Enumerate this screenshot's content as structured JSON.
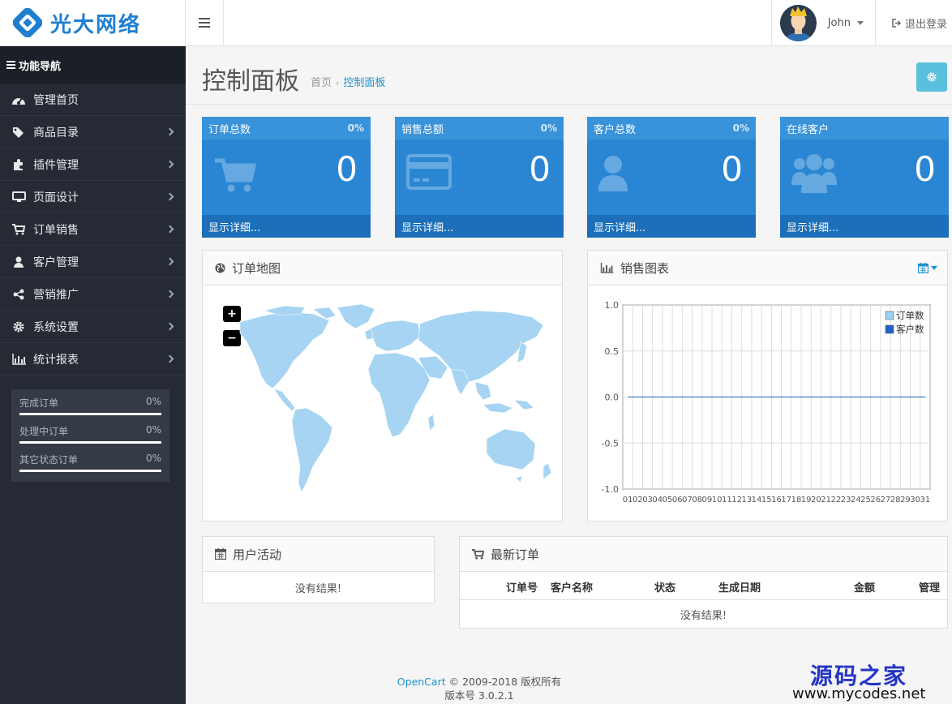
{
  "header": {
    "brand": "光大网络",
    "user_name": "John",
    "logout_label": "退出登录"
  },
  "sidebar": {
    "title": "功能导航",
    "items": [
      {
        "label": "管理首页",
        "icon": "dashboard-icon",
        "has_children": false
      },
      {
        "label": "商品目录",
        "icon": "tag-icon",
        "has_children": true
      },
      {
        "label": "插件管理",
        "icon": "puzzle-icon",
        "has_children": true
      },
      {
        "label": "页面设计",
        "icon": "desktop-icon",
        "has_children": true
      },
      {
        "label": "订单销售",
        "icon": "cart-icon",
        "has_children": true
      },
      {
        "label": "客户管理",
        "icon": "user-icon",
        "has_children": true
      },
      {
        "label": "营销推广",
        "icon": "share-icon",
        "has_children": true
      },
      {
        "label": "系统设置",
        "icon": "cog-icon",
        "has_children": true
      },
      {
        "label": "统计报表",
        "icon": "bar-chart-icon",
        "has_children": true
      }
    ],
    "progress": [
      {
        "label": "完成订单",
        "value": "0%"
      },
      {
        "label": "处理中订单",
        "value": "0%"
      },
      {
        "label": "其它状态订单",
        "value": "0%"
      }
    ]
  },
  "page": {
    "title": "控制面板",
    "breadcrumb_home": "首页",
    "breadcrumb_current": "控制面板"
  },
  "tiles": [
    {
      "title": "订单总数",
      "percent": "0%",
      "value": "0",
      "footer": "显示详细...",
      "icon": "cart-icon"
    },
    {
      "title": "销售总额",
      "percent": "0%",
      "value": "0",
      "footer": "显示详细...",
      "icon": "credit-card-icon"
    },
    {
      "title": "客户总数",
      "percent": "0%",
      "value": "0",
      "footer": "显示详细...",
      "icon": "user-icon"
    },
    {
      "title": "在线客户",
      "percent": "",
      "value": "0",
      "footer": "显示详细...",
      "icon": "users-icon"
    }
  ],
  "map_panel": {
    "title": "订单地图",
    "zoom_in": "+",
    "zoom_out": "−"
  },
  "chart_panel": {
    "title": "销售图表"
  },
  "chart_data": {
    "type": "line",
    "x": [
      "01",
      "02",
      "03",
      "04",
      "05",
      "06",
      "07",
      "08",
      "09",
      "10",
      "11",
      "12",
      "13",
      "14",
      "15",
      "16",
      "17",
      "18",
      "19",
      "20",
      "21",
      "22",
      "23",
      "24",
      "25",
      "26",
      "27",
      "28",
      "29",
      "30",
      "31"
    ],
    "series": [
      {
        "name": "订单数",
        "values": [
          0,
          0,
          0,
          0,
          0,
          0,
          0,
          0,
          0,
          0,
          0,
          0,
          0,
          0,
          0,
          0,
          0,
          0,
          0,
          0,
          0,
          0,
          0,
          0,
          0,
          0,
          0,
          0,
          0,
          0,
          0
        ]
      },
      {
        "name": "客户数",
        "values": [
          0,
          0,
          0,
          0,
          0,
          0,
          0,
          0,
          0,
          0,
          0,
          0,
          0,
          0,
          0,
          0,
          0,
          0,
          0,
          0,
          0,
          0,
          0,
          0,
          0,
          0,
          0,
          0,
          0,
          0,
          0
        ]
      }
    ],
    "yticks": [
      "1.0",
      "0.5",
      "0.0",
      "-0.5",
      "-1.0"
    ],
    "ylim": [
      -1,
      1
    ],
    "grid": true,
    "legend": "top-right",
    "colors": [
      "#9cd1f5",
      "#1e62c8"
    ]
  },
  "activity_panel": {
    "title": "用户活动",
    "empty": "没有结果!"
  },
  "orders_panel": {
    "title": "最新订单",
    "columns": [
      "订单号",
      "客户名称",
      "状态",
      "生成日期",
      "金额",
      "管理"
    ],
    "empty": "没有结果!"
  },
  "footer": {
    "link": "OpenCart",
    "copyright": " © 2009-2018 版权所有",
    "version": "版本号 3.0.2.1"
  },
  "watermark": {
    "name": "源码之家",
    "url": "www.mycodes.net"
  }
}
